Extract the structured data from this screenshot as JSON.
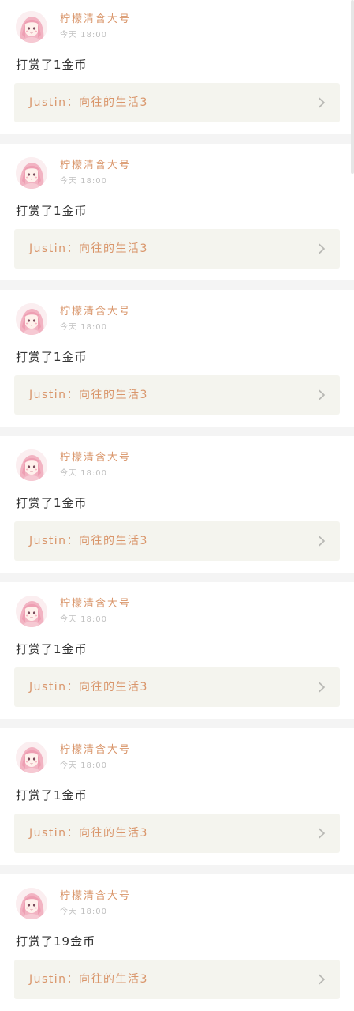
{
  "feed": {
    "items": [
      {
        "username": "柠檬清含大号",
        "time": "今天 18:00",
        "action": "打赏了1金币",
        "link_text": "Justin：向往的生活3"
      },
      {
        "username": "柠檬清含大号",
        "time": "今天 18:00",
        "action": "打赏了1金币",
        "link_text": "Justin：向往的生活3"
      },
      {
        "username": "柠檬清含大号",
        "time": "今天 18:00",
        "action": "打赏了1金币",
        "link_text": "Justin：向往的生活3"
      },
      {
        "username": "柠檬清含大号",
        "time": "今天 18:00",
        "action": "打赏了1金币",
        "link_text": "Justin：向往的生活3"
      },
      {
        "username": "柠檬清含大号",
        "time": "今天 18:00",
        "action": "打赏了1金币",
        "link_text": "Justin：向往的生活3"
      },
      {
        "username": "柠檬清含大号",
        "time": "今天 18:00",
        "action": "打赏了1金币",
        "link_text": "Justin：向往的生活3"
      },
      {
        "username": "柠檬清含大号",
        "time": "今天 18:00",
        "action": "打赏了19金币",
        "link_text": "Justin：向往的生活3"
      }
    ]
  },
  "colors": {
    "accent": "#d9956a",
    "link_box_bg": "#f4f4ee",
    "separator": "#f4f4f4"
  }
}
